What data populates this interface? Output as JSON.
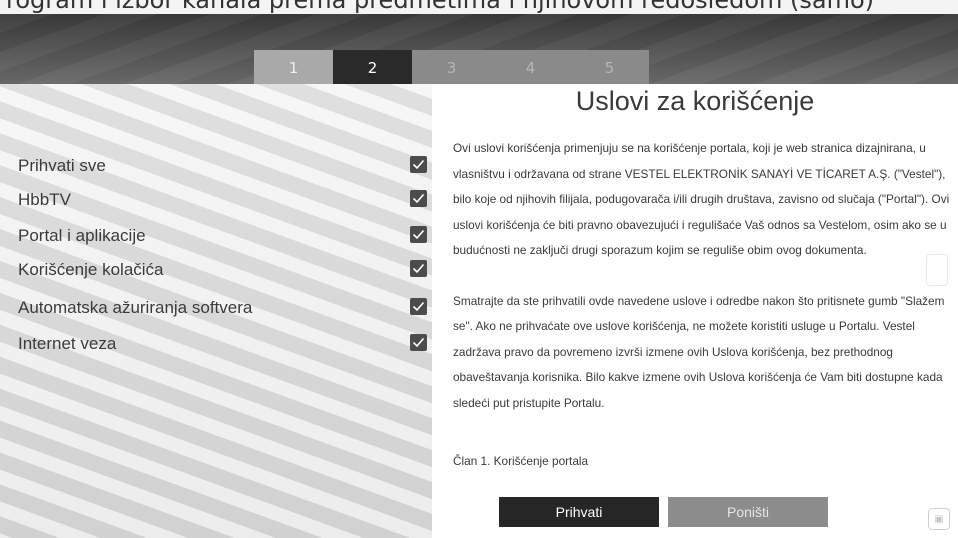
{
  "caption": "rogram i izbor kanala prema predmetima i njihovom redosledom (samo)",
  "steps": [
    "1",
    "2",
    "3",
    "4",
    "5"
  ],
  "active_step": "2",
  "options": [
    {
      "label": "Prihvati sve",
      "checked": true
    },
    {
      "label": "HbbTV",
      "checked": true
    },
    {
      "label": "Portal i aplikacije",
      "checked": true
    },
    {
      "label": "Korišćenje kolačića",
      "checked": true
    },
    {
      "label": "Automatska ažuriranja softvera",
      "checked": true
    },
    {
      "label": "Internet veza",
      "checked": true
    }
  ],
  "terms": {
    "title": "Uslovi za korišćenje",
    "paragraph1": "Ovi uslovi korišćenja primenjuju se na korišćenje portala, koji je web stranica dizajnirana, u vlasništvu i održavana od strane VESTEL ELEKTRONİK SANAYİ VE TİCARET A.Ş. (\"Vestel\"), bilo koje od njihovih filijala, podugovarača i/ili drugih društava, zavisno od slučaja (\"Portal\"). Ovi uslovi korišćenja će biti pravno obavezujući i regulišaće Vaš odnos sa Vestelom, osim ako se u budućnosti ne zaključi drugi sporazum kojim se reguliše obim ovog dokumenta.",
    "paragraph2": "Smatrajte da ste prihvatili ovde navedene uslove i odredbe nakon što pritisnete gumb \"Slažem se\". Ako ne prihvaćate ove uslove korišćenja, ne možete koristiti usluge u Portalu. Vestel zadržava pravo da povremeno izvrši izmene ovih Uslova korišćenja, bez prethodnog obaveštavanja korisnika. Bilo kakve izmene ovih Uslova korišćenja će Vam biti dostupne kada sledeći put pristupite Portalu.",
    "article": "Član 1.  Korišćenje portala"
  },
  "buttons": {
    "accept": "Prihvati",
    "cancel": "Poništi"
  },
  "colors": {
    "active_step_bg": "#2a2a2a",
    "accept_bg": "#262626",
    "cancel_bg": "#8c8c8c",
    "checkbox_bg": "#4c4c4c"
  }
}
